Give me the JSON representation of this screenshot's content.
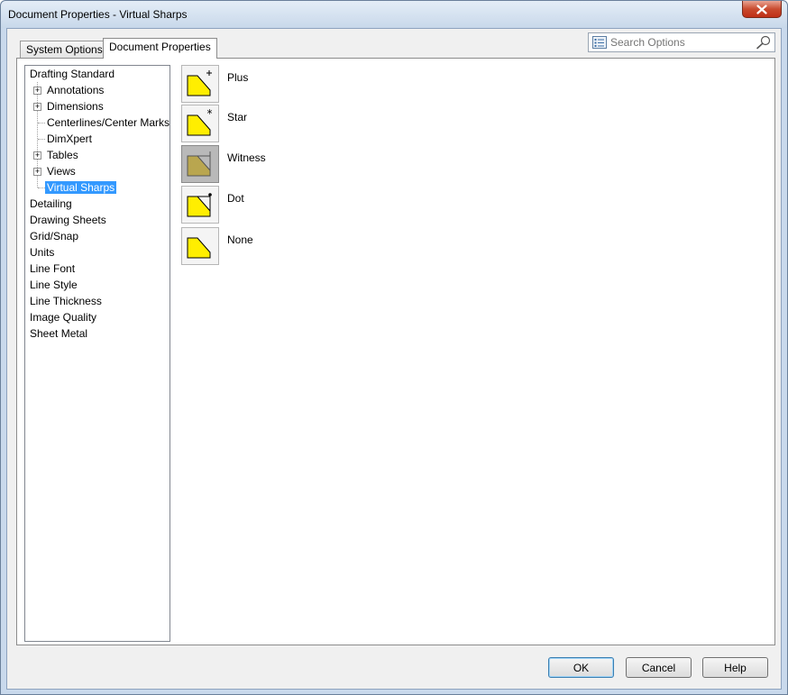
{
  "window": {
    "title": "Document Properties - Virtual Sharps"
  },
  "tabs": {
    "system": "System Options",
    "document": "Document Properties"
  },
  "search": {
    "placeholder": "Search Options"
  },
  "tree": {
    "items": [
      {
        "label": "Drafting Standard"
      },
      {
        "label": "Annotations"
      },
      {
        "label": "Dimensions"
      },
      {
        "label": "Centerlines/Center Marks"
      },
      {
        "label": "DimXpert"
      },
      {
        "label": "Tables"
      },
      {
        "label": "Views"
      },
      {
        "label": "Virtual Sharps"
      },
      {
        "label": "Detailing"
      },
      {
        "label": "Drawing Sheets"
      },
      {
        "label": "Grid/Snap"
      },
      {
        "label": "Units"
      },
      {
        "label": "Line Font"
      },
      {
        "label": "Line Style"
      },
      {
        "label": "Line Thickness"
      },
      {
        "label": "Image Quality"
      },
      {
        "label": "Sheet Metal"
      }
    ],
    "selected": "Virtual Sharps"
  },
  "sharps": {
    "options": [
      {
        "label": "Plus",
        "icon": "plus-sharp-icon"
      },
      {
        "label": "Star",
        "icon": "star-sharp-icon"
      },
      {
        "label": "Witness",
        "icon": "witness-sharp-icon"
      },
      {
        "label": "Dot",
        "icon": "dot-sharp-icon"
      },
      {
        "label": "None",
        "icon": "none-sharp-icon"
      }
    ],
    "selected": "Witness"
  },
  "buttons": {
    "ok": "OK",
    "cancel": "Cancel",
    "help": "Help"
  },
  "colors": {
    "selection": "#3399ff",
    "sharp_fill": "#ffee00"
  }
}
